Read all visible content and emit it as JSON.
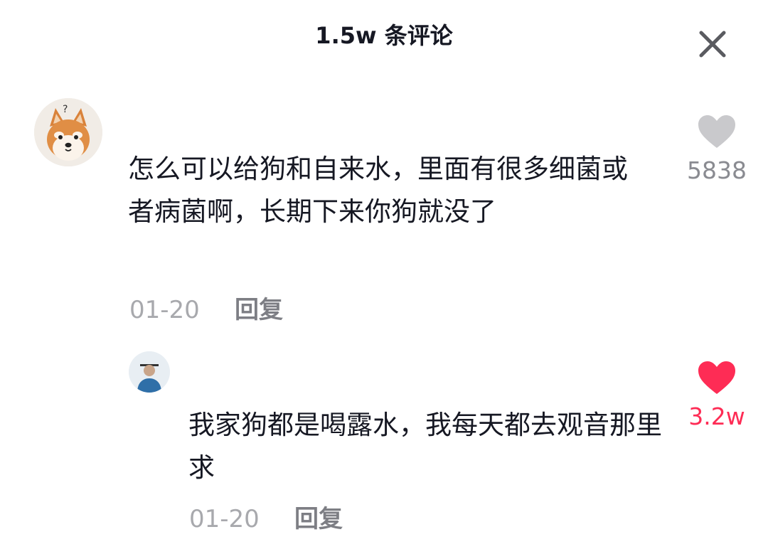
{
  "header": {
    "title": "1.5w 条评论",
    "close_icon": "close-icon"
  },
  "comments": [
    {
      "avatar": "shiba-dog-avatar",
      "text": "怎么可以给狗和自来水，里面有很多细菌或者病菌啊，长期下来你狗就没了",
      "date": "01-20",
      "reply_label": "回复",
      "likes": "5838",
      "liked": false,
      "like_color": "#c9c9cc"
    },
    {
      "avatar": "person-avatar",
      "text": "我家狗都是喝露水，我每天都去观音那里求",
      "date": "01-20",
      "reply_label": "回复",
      "likes": "3.2w",
      "liked": true,
      "like_color": "#fe2c55"
    }
  ]
}
